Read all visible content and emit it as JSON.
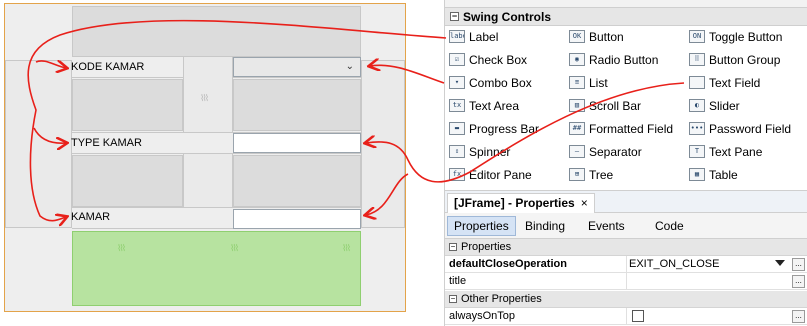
{
  "designer": {
    "labels": {
      "kode_kamar": "KODE KAMAR",
      "type_kamar": "TYPE KAMAR",
      "kamar": "KAMAR"
    }
  },
  "palette": {
    "category_title": "Swing Controls",
    "items": [
      {
        "label": "Label",
        "icon": "label-icon",
        "glyph": "label"
      },
      {
        "label": "Button",
        "icon": "button-icon",
        "glyph": "OK"
      },
      {
        "label": "Toggle Button",
        "icon": "toggle-button-icon",
        "glyph": "ON"
      },
      {
        "label": "Check Box",
        "icon": "check-box-icon",
        "glyph": "☑"
      },
      {
        "label": "Radio Button",
        "icon": "radio-button-icon",
        "glyph": "◉"
      },
      {
        "label": "Button Group",
        "icon": "button-group-icon",
        "glyph": "⠿"
      },
      {
        "label": "Combo Box",
        "icon": "combo-box-icon",
        "glyph": "▾"
      },
      {
        "label": "List",
        "icon": "list-icon",
        "glyph": "≡"
      },
      {
        "label": "Text Field",
        "icon": "text-field-icon",
        "glyph": ""
      },
      {
        "label": "Text Area",
        "icon": "text-area-icon",
        "glyph": "tx"
      },
      {
        "label": "Scroll Bar",
        "icon": "scroll-bar-icon",
        "glyph": "▥"
      },
      {
        "label": "Slider",
        "icon": "slider-icon",
        "glyph": "◐"
      },
      {
        "label": "Progress Bar",
        "icon": "progress-bar-icon",
        "glyph": "▬"
      },
      {
        "label": "Formatted Field",
        "icon": "formatted-field-icon",
        "glyph": "##"
      },
      {
        "label": "Password Field",
        "icon": "password-field-icon",
        "glyph": "•••"
      },
      {
        "label": "Spinner",
        "icon": "spinner-icon",
        "glyph": "⇕"
      },
      {
        "label": "Separator",
        "icon": "separator-icon",
        "glyph": "—"
      },
      {
        "label": "Text Pane",
        "icon": "text-pane-icon",
        "glyph": "T"
      },
      {
        "label": "Editor Pane",
        "icon": "editor-pane-icon",
        "glyph": "fx"
      },
      {
        "label": "Tree",
        "icon": "tree-icon",
        "glyph": "⊞"
      },
      {
        "label": "Table",
        "icon": "table-icon",
        "glyph": "▦"
      }
    ]
  },
  "properties": {
    "window_title": "[JFrame] - Properties",
    "close_glyph": "×",
    "tabs": [
      "Properties",
      "Binding",
      "Events",
      "Code"
    ],
    "section_properties": "Properties",
    "section_other": "Other Properties",
    "rows": [
      {
        "name": "defaultCloseOperation",
        "value": "EXIT_ON_CLOSE"
      },
      {
        "name": "title",
        "value": ""
      },
      {
        "name": "alwaysOnTop",
        "value": ""
      }
    ],
    "ellipsis": "..."
  },
  "colors": {
    "form_border": "#e3a34a",
    "arrow": "#e8201a",
    "green_panel": "#b7e3a0",
    "active_tab": "#d5e3f5"
  }
}
